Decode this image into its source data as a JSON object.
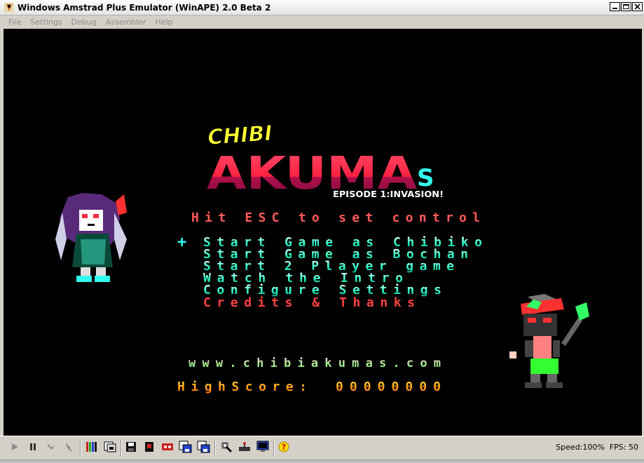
{
  "window": {
    "title": "Windows Amstrad Plus Emulator (WinAPE) 2.0 Beta 2"
  },
  "menu": [
    "File",
    "Settings",
    "Debug",
    "Assembler",
    "Help"
  ],
  "game": {
    "logo_top": "CHIBI",
    "logo_main": "AKUMA",
    "logo_s": "S",
    "episode": "EPISODE 1:INVASION!",
    "prompt": "Hit ESC to set control",
    "cursor": "+",
    "options": [
      "Start Game as Chibiko",
      "Start Game as Bochan",
      "Start 2 Player game",
      "Watch the Intro",
      "Configure Settings",
      "Credits & Thanks"
    ],
    "website": "www.chibiakumas.com",
    "highscore_label": "HighScore:",
    "highscore_value": "00000000"
  },
  "colors": {
    "logo_yellow": "#ffff33",
    "logo_red": "#ff2a4a",
    "logo_cyan": "#33ffee",
    "prompt_red": "#ff5a5a",
    "menu_cyan": "#33ffcc",
    "credits_red": "#ff4040",
    "website_pink": "#ff9999",
    "score_orange": "#ffaa33"
  },
  "toolbar": {
    "icons": [
      "play-icon",
      "pause-icon",
      "step-icon",
      "step-over-icon",
      "tape-icon",
      "disk-icon",
      "save-icon",
      "snapshot-icon",
      "tape-save-icon",
      "disk-save-a-icon",
      "disk-save-b-icon",
      "debug-icon",
      "joystick-icon",
      "monitor-icon",
      "help-icon"
    ]
  },
  "status": {
    "speed": "Speed:100%",
    "fps": "FPS: 50"
  }
}
